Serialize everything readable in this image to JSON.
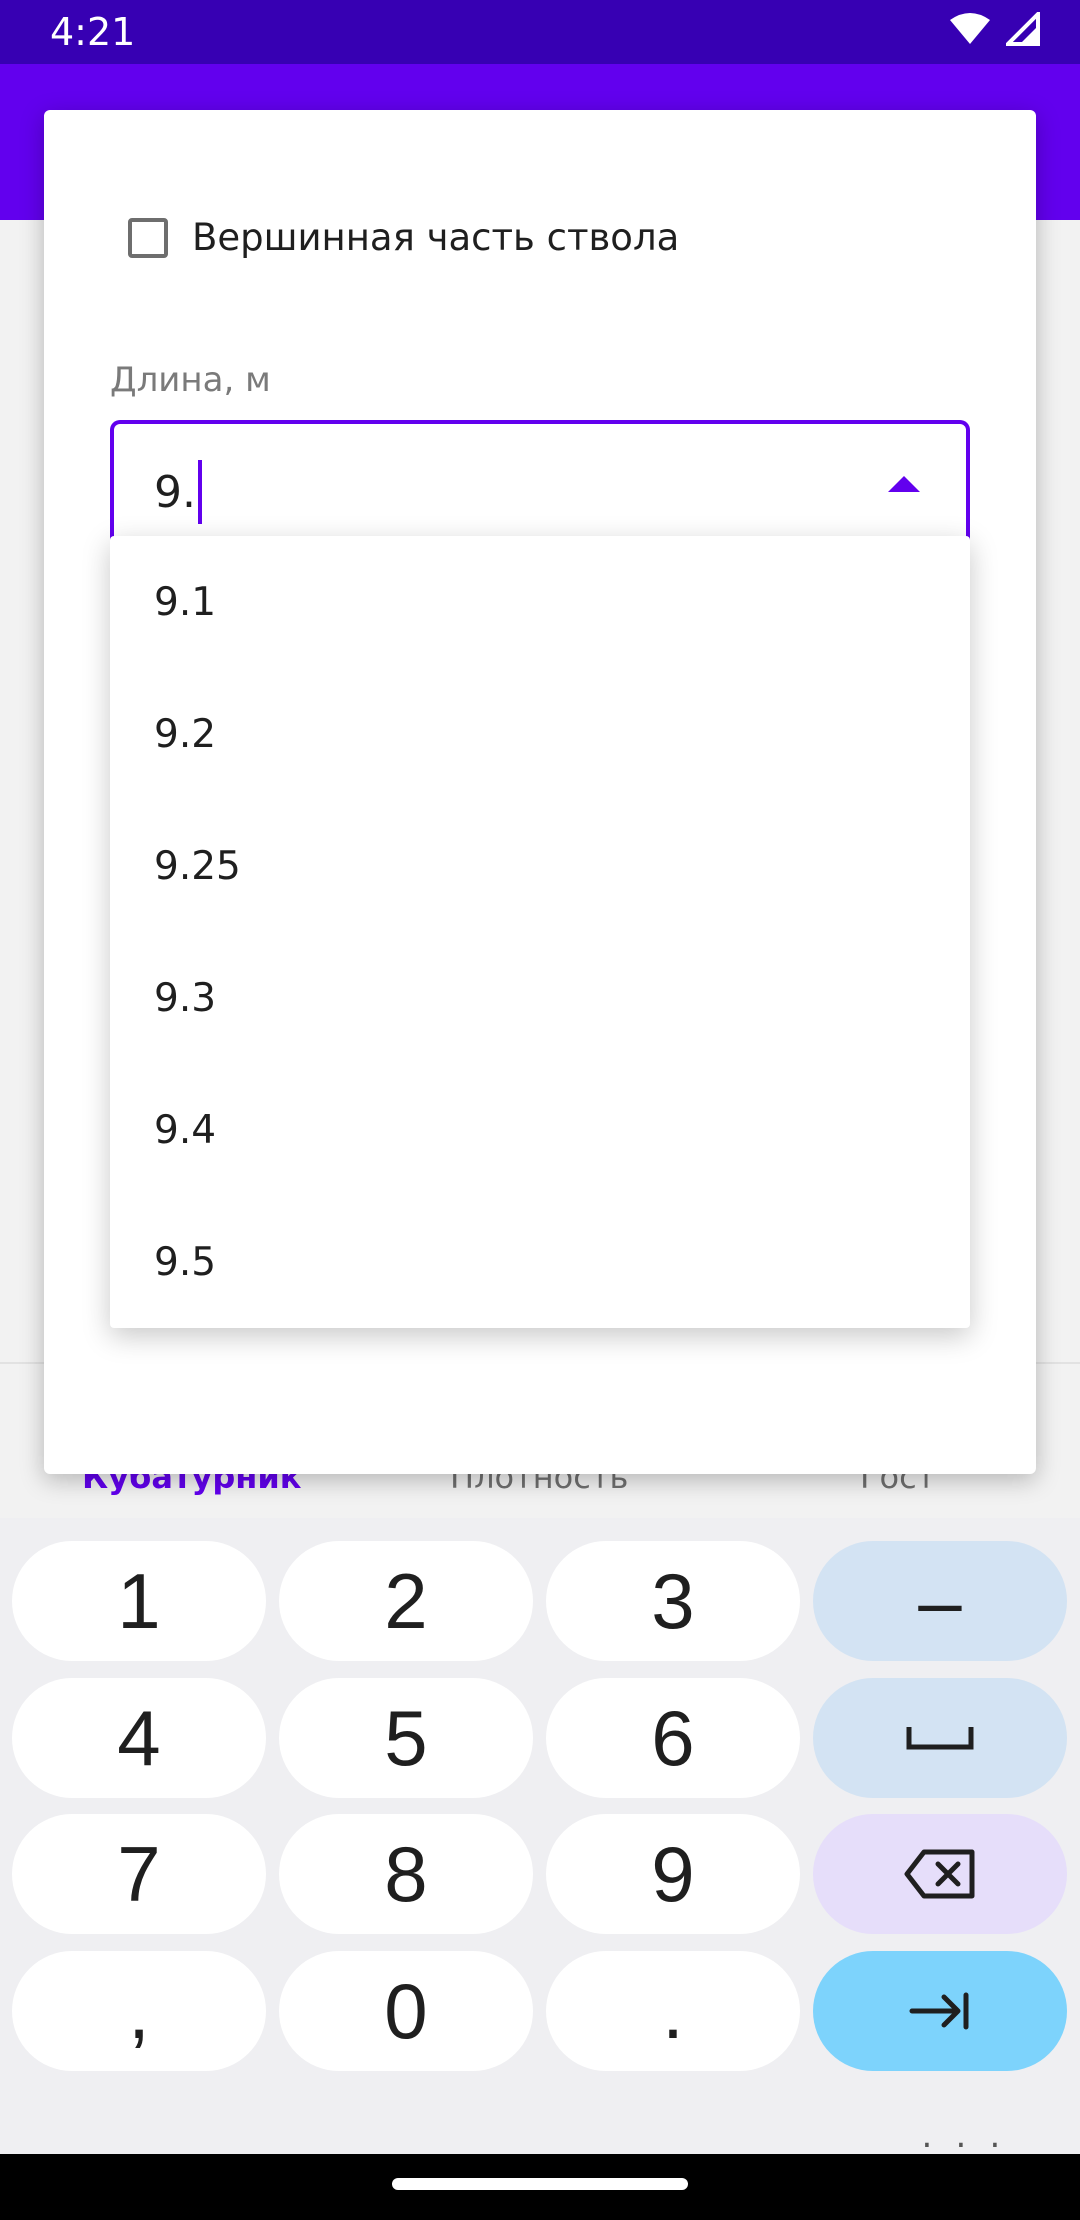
{
  "status_bar": {
    "time": "4:21"
  },
  "background": {
    "tabs": [
      {
        "label": "Кубатурник"
      },
      {
        "label": "Плотность"
      },
      {
        "label": "Гост"
      }
    ]
  },
  "dialog": {
    "checkbox_label": "Вершинная часть ствола",
    "checkbox_checked": false,
    "field_label": "Длина, м",
    "field_value": "9.",
    "options": [
      {
        "label": "9.1"
      },
      {
        "label": "9.2"
      },
      {
        "label": "9.25"
      },
      {
        "label": "9.3"
      },
      {
        "label": "9.4"
      },
      {
        "label": "9.5"
      }
    ]
  },
  "keyboard": {
    "keys": [
      "1",
      "2",
      "3",
      "–",
      "4",
      "5",
      "6",
      "␣",
      "7",
      "8",
      "9",
      "⌫",
      ",",
      "0",
      ".",
      "→|"
    ]
  },
  "colors": {
    "status_bar": "#3700b3",
    "app_bar": "#6200ee",
    "accent": "#6200ee",
    "enter_key": "#7dd3fc"
  }
}
